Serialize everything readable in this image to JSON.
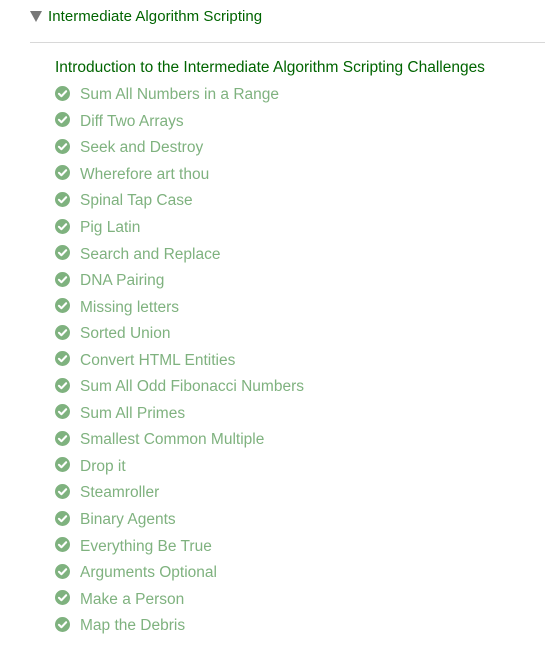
{
  "section": {
    "title": "Intermediate Algorithm Scripting",
    "expanded": true
  },
  "intro": {
    "label": "Introduction to the Intermediate Algorithm Scripting Challenges"
  },
  "colors": {
    "title_green": "#006400",
    "completed_green": "#7fb27f",
    "check_fill": "#7fb27f",
    "caret": "#777777",
    "divider": "#d8d8d8"
  },
  "challenges": [
    {
      "label": "Sum All Numbers in a Range",
      "icon": "check-circle-icon",
      "completed": true
    },
    {
      "label": "Diff Two Arrays",
      "icon": "check-circle-icon",
      "completed": true
    },
    {
      "label": "Seek and Destroy",
      "icon": "check-circle-icon",
      "completed": true
    },
    {
      "label": "Wherefore art thou",
      "icon": "check-circle-icon",
      "completed": true
    },
    {
      "label": "Spinal Tap Case",
      "icon": "check-circle-icon",
      "completed": true
    },
    {
      "label": "Pig Latin",
      "icon": "check-circle-icon",
      "completed": true
    },
    {
      "label": "Search and Replace",
      "icon": "check-circle-icon",
      "completed": true
    },
    {
      "label": "DNA Pairing",
      "icon": "check-circle-icon",
      "completed": true
    },
    {
      "label": "Missing letters",
      "icon": "check-circle-icon",
      "completed": true
    },
    {
      "label": "Sorted Union",
      "icon": "check-circle-icon",
      "completed": true
    },
    {
      "label": "Convert HTML Entities",
      "icon": "check-circle-icon",
      "completed": true
    },
    {
      "label": "Sum All Odd Fibonacci Numbers",
      "icon": "check-circle-icon",
      "completed": true
    },
    {
      "label": "Sum All Primes",
      "icon": "check-circle-icon",
      "completed": true
    },
    {
      "label": "Smallest Common Multiple",
      "icon": "check-circle-icon",
      "completed": true
    },
    {
      "label": "Drop it",
      "icon": "check-circle-icon",
      "completed": true
    },
    {
      "label": "Steamroller",
      "icon": "check-circle-icon",
      "completed": true
    },
    {
      "label": "Binary Agents",
      "icon": "check-circle-icon",
      "completed": true
    },
    {
      "label": "Everything Be True",
      "icon": "check-circle-icon",
      "completed": true
    },
    {
      "label": "Arguments Optional",
      "icon": "check-circle-icon",
      "completed": true
    },
    {
      "label": "Make a Person",
      "icon": "check-circle-icon",
      "completed": true
    },
    {
      "label": "Map the Debris",
      "icon": "check-circle-icon",
      "completed": true
    }
  ]
}
